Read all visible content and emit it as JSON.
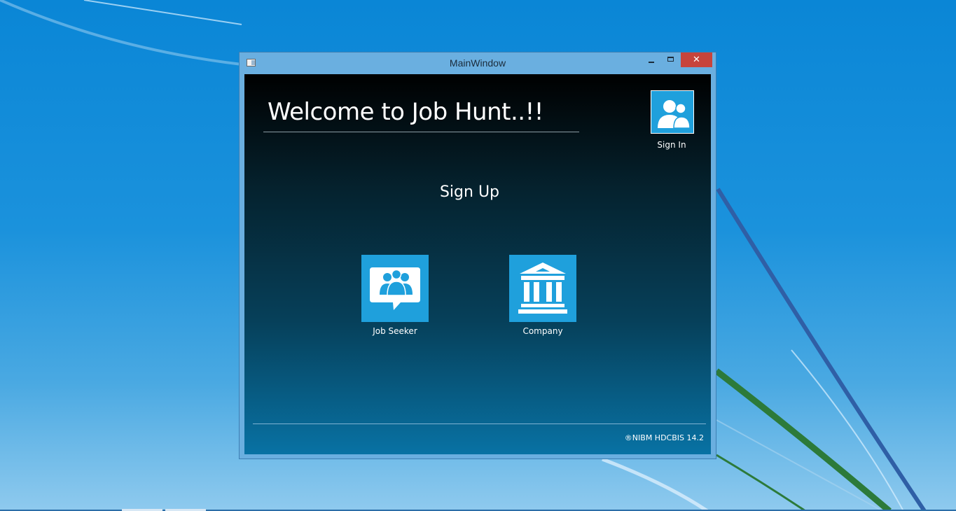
{
  "window": {
    "title": "MainWindow",
    "close_glyph": "✕"
  },
  "main": {
    "welcome_text": "Welcome to Job Hunt..!!",
    "signup_title": "Sign Up",
    "signin": {
      "label": "Sign In",
      "icon": "users-icon"
    },
    "tiles": [
      {
        "label": "Job Seeker",
        "icon": "chat-people-icon"
      },
      {
        "label": "Company",
        "icon": "building-icon"
      }
    ],
    "footer": "®NIBM HDCBIS 14.2"
  },
  "colors": {
    "tile": "#1fa0dc",
    "close_button": "#c7443b",
    "desktop": "#0a86d6"
  }
}
